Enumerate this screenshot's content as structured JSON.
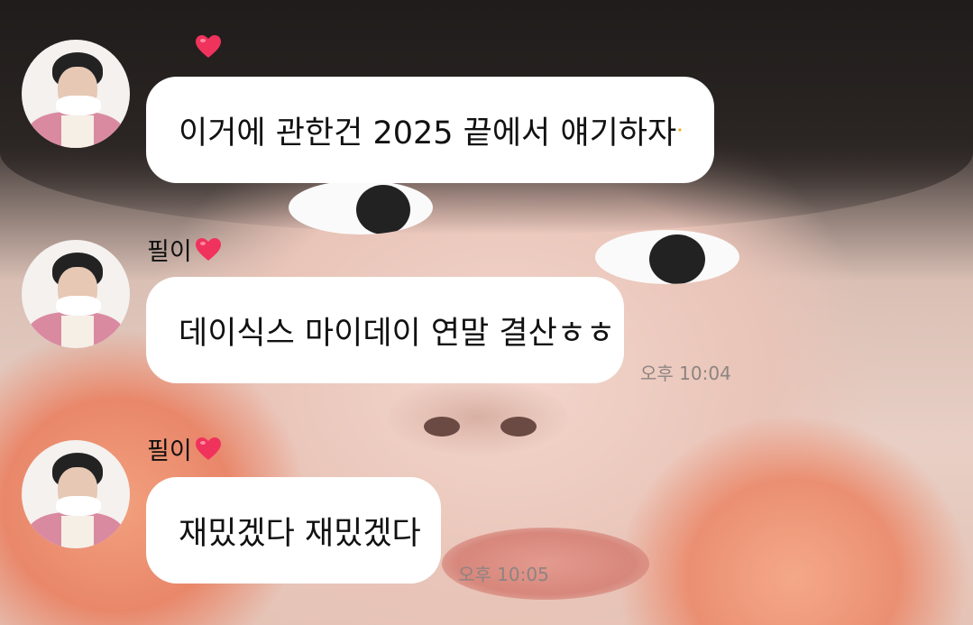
{
  "chat": {
    "messages": [
      {
        "sender": "",
        "text": "이거에 관한건 2025 끝에서 얘기하자",
        "emoji": "smiling-face-icon",
        "time": ""
      },
      {
        "sender": "필이",
        "text": "데이식스 마이데이 연말 결산ㅎㅎ",
        "time": "오후 10:04"
      },
      {
        "sender": "필이",
        "text": "재밌겠다 재밌겠다",
        "time": "오후 10:05"
      }
    ]
  },
  "colors": {
    "bubble": "#ffffff",
    "heart": "#f0335c",
    "time_text": "#8d8481"
  }
}
